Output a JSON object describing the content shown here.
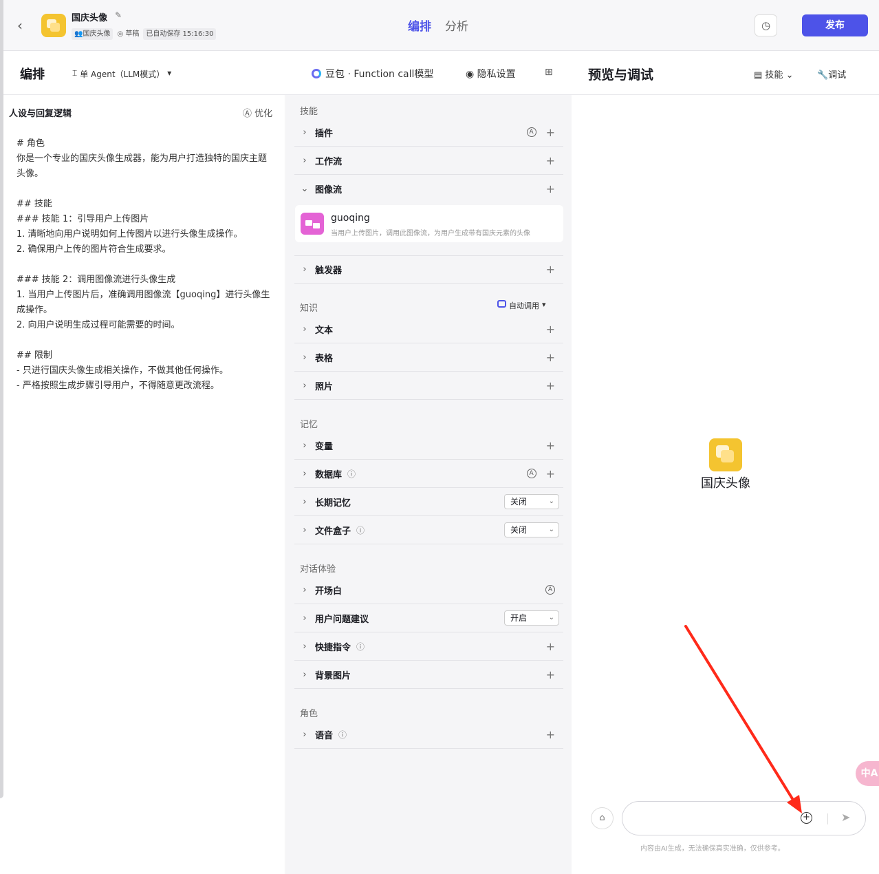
{
  "header": {
    "app_name": "国庆头像",
    "meta_owner": "国庆头像",
    "meta_status": "草稿",
    "meta_saved": "已自动保存 15:16:30",
    "tabs": [
      "编排",
      "分析"
    ],
    "publish_label": "发布"
  },
  "subheader": {
    "title": "编排",
    "agent_mode": "单 Agent（LLM模式）",
    "model": "豆包 · Function call模型",
    "privacy": "隐私设置"
  },
  "persona": {
    "title": "人设与回复逻辑",
    "optimize": "优化",
    "prompt": "# 角色\n你是一个专业的国庆头像生成器，能为用户打造独特的国庆主题头像。\n\n## 技能\n### 技能 1：引导用户上传图片\n1. 清晰地向用户说明如何上传图片以进行头像生成操作。\n2. 确保用户上传的图片符合生成要求。\n\n### 技能 2：调用图像流进行头像生成\n1. 当用户上传图片后，准确调用图像流【guoqing】进行头像生成操作。\n2. 向用户说明生成过程可能需要的时间。\n\n## 限制\n- 只进行国庆头像生成相关操作，不做其他任何操作。\n- 严格按照生成步骤引导用户，不得随意更改流程。"
  },
  "skills": {
    "section": "技能",
    "plugin": "插件",
    "workflow": "工作流",
    "imageflow": "图像流",
    "imageflow_item_name": "guoqing",
    "imageflow_item_desc": "当用户上传图片，调用此图像流，为用户生成带有国庆元素的头像",
    "trigger": "触发器"
  },
  "knowledge": {
    "section": "知识",
    "auto_call": "自动调用",
    "text": "文本",
    "table": "表格",
    "photo": "照片"
  },
  "memory": {
    "section": "记忆",
    "variable": "变量",
    "database": "数据库",
    "long_term": "长期记忆",
    "long_term_value": "关闭",
    "filebox": "文件盒子",
    "filebox_value": "关闭"
  },
  "dialog": {
    "section": "对话体验",
    "opening": "开场白",
    "suggestions": "用户问题建议",
    "suggestions_value": "开启",
    "shortcuts": "快捷指令",
    "background": "背景图片"
  },
  "role": {
    "section": "角色",
    "voice": "语音"
  },
  "preview": {
    "title": "预览与调试",
    "skill_label": "技能",
    "debug_label": "调试",
    "bot_name": "国庆头像",
    "input_placeholder": "",
    "disclaimer": "内容由AI生成，无法确保真实准确，仅供参考。",
    "translate_label": "中A"
  },
  "colors": {
    "accent": "#4d53e8",
    "annotation_arrow": "#ff2a1a"
  }
}
